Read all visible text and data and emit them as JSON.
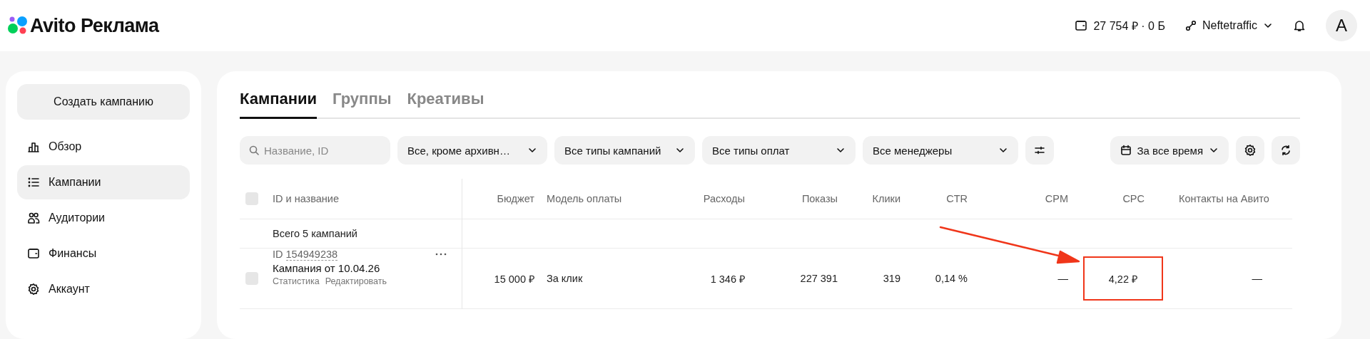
{
  "header": {
    "logo_text": "Avito Реклама",
    "balance": "27 754 ₽ · 0 Б",
    "account": "Neftetraffic",
    "avatar_letter": "A"
  },
  "sidebar": {
    "create_button": "Создать кампанию",
    "items": [
      {
        "label": "Обзор",
        "kind": "chart",
        "selected": false
      },
      {
        "label": "Кампании",
        "kind": "list",
        "selected": true
      },
      {
        "label": "Аудитории",
        "kind": "people",
        "selected": false
      },
      {
        "label": "Финансы",
        "kind": "wallet",
        "selected": false
      },
      {
        "label": "Аккаунт",
        "kind": "gear",
        "selected": false
      }
    ]
  },
  "tabs": [
    {
      "label": "Кампании",
      "selected": true
    },
    {
      "label": "Группы",
      "selected": false
    },
    {
      "label": "Креативы",
      "selected": false
    }
  ],
  "filters": {
    "search": {
      "placeholder": "Название, ID"
    },
    "dropdowns": [
      "Все, кроме архивн…",
      "Все типы кампаний",
      "Все типы оплат",
      "Все менеджеры"
    ],
    "period": "За все время"
  },
  "table": {
    "all_checked": false,
    "name_column": "ID и название",
    "columns": [
      "Бюджет",
      "Модель оплаты",
      "Расходы",
      "Показы",
      "Клики",
      "CTR",
      "CPM",
      "CPC",
      "Контакты на Авито"
    ],
    "summary": "Всего 5 кампаний",
    "rows": [
      {
        "checked": false,
        "id_label": "ID",
        "id": "154949238",
        "name": "Кампания от 10.04.26",
        "links": [
          "Статистика",
          "Редактировать"
        ],
        "cells": [
          {
            "text": "15 000 ₽",
            "highlighted": false
          },
          {
            "text": "За клик",
            "highlighted": false
          },
          {
            "text": "1 346 ₽",
            "highlighted": false
          },
          {
            "text": "227 391",
            "highlighted": false
          },
          {
            "text": "319",
            "highlighted": false
          },
          {
            "text": "0,14 %",
            "highlighted": false
          },
          {
            "text": "—",
            "highlighted": false
          },
          {
            "text": "4,22 ₽",
            "highlighted": true
          },
          {
            "text": "—",
            "highlighted": false
          }
        ]
      }
    ]
  }
}
